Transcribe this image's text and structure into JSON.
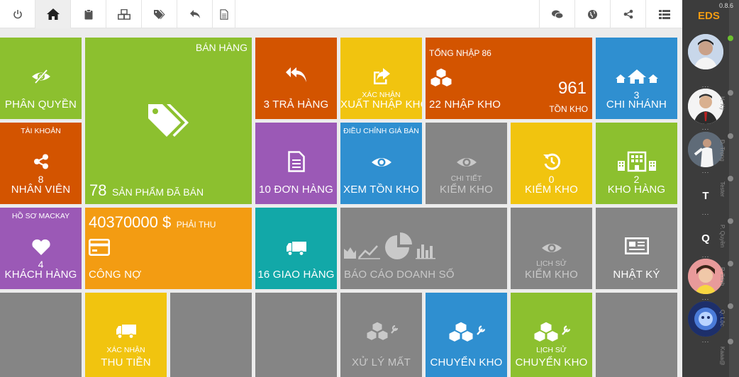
{
  "toolbar": {
    "left_icons": [
      "power-icon",
      "home-icon",
      "clipboard-icon",
      "cubes-icon",
      "tags-icon",
      "reply-icon",
      "document-icon"
    ],
    "right_icons": [
      "chat-icon",
      "globe-icon",
      "share-icon",
      "list-icon"
    ]
  },
  "tiles": {
    "phan_quyen": {
      "label": "PHÂN QUYỀN"
    },
    "ban_hang": {
      "title": "BÁN HÀNG",
      "count": "78",
      "label": "SẢN PHẨM ĐÃ BÁN"
    },
    "tra_hang": {
      "label": "3 TRẢ HÀNG"
    },
    "xuat_nhap_kho": {
      "small": "XÁC NHẬN",
      "label": "XUẤT NHẬP KHO"
    },
    "nhap_kho": {
      "title": "TỔNG NHẬP 86",
      "value": "961",
      "label": "22 NHẬP KHO",
      "sub": "TỒN KHO"
    },
    "chi_nhanh": {
      "count": "3",
      "label": "CHI NHÁNH"
    },
    "nhan_vien": {
      "small": "TÀI KHOẢN",
      "count": "8",
      "label": "NHÂN VIÊN"
    },
    "don_hang": {
      "label": "10 ĐƠN HÀNG"
    },
    "xem_ton_kho": {
      "small": "ĐIỀU CHỈNH GIÁ BÁN",
      "label": "XEM TỒN KHO"
    },
    "chi_tiet_kiem_kho": {
      "small": "CHI TIẾT",
      "label": "KIỂM KHO"
    },
    "kiem_kho": {
      "count": "0",
      "label": "KIỂM KHO"
    },
    "kho_hang": {
      "count": "2",
      "label": "KHO HÀNG"
    },
    "khach_hang": {
      "small": "HỒ SƠ MACKAY",
      "count": "4",
      "label": "KHÁCH HÀNG"
    },
    "cong_no": {
      "amount": "40370000 $",
      "amount_note": "PHẢI THU",
      "label": "CÔNG NỢ"
    },
    "giao_hang": {
      "label": "16 GIAO HÀNG"
    },
    "bao_cao": {
      "label": "BÁO CÁO DOANH SỐ"
    },
    "lich_su_kiem_kho": {
      "small": "LỊCH SỬ",
      "label": "KIỂM KHO"
    },
    "nhat_ky": {
      "label": "NHẬT KÝ"
    },
    "thu_tien": {
      "small": "XÁC NHẬN",
      "label": "THU TIỀN"
    },
    "xu_ly_mat": {
      "label": "XỬ LÝ MẤT"
    },
    "chuyen_kho": {
      "label": "CHUYỂN KHO"
    },
    "lich_su_chuyen_kho": {
      "small": "LỊCH SỬ",
      "label": "CHUYỂN KHO"
    }
  },
  "sidebar": {
    "version": "0.8.6",
    "brand": "EDS",
    "users": [
      {
        "initial": "",
        "name": "",
        "online": true,
        "color": "#b7c9e0"
      },
      {
        "initial": "",
        "name": "H. Kỳ",
        "online": false,
        "color": "#f0f0f0"
      },
      {
        "initial": "",
        "name": "Đ. Trọng",
        "online": false,
        "color": "#6d7a8a"
      },
      {
        "initial": "T",
        "name": "Tester",
        "online": false,
        "color": ""
      },
      {
        "initial": "Q",
        "name": "P. Quyền",
        "online": false,
        "color": ""
      },
      {
        "initial": "",
        "name": "P. Trinh",
        "online": false,
        "color": "#d98b8b"
      },
      {
        "initial": "",
        "name": "Q. Lộc",
        "online": false,
        "color": "#3a5fb0"
      },
      {
        "initial": "",
        "name": "Kaaa@",
        "online": false,
        "color": ""
      }
    ]
  },
  "colors": {
    "green": "#8cc02f",
    "orange": "#d35400",
    "yellow": "#f1c40f",
    "blue": "#2f8fd0",
    "purple": "#9b59b6",
    "teal": "#12a8a8",
    "amber": "#f39c12",
    "gray": "#858585",
    "brand": "#f39c12",
    "sidebar": "#3c3c3c"
  }
}
